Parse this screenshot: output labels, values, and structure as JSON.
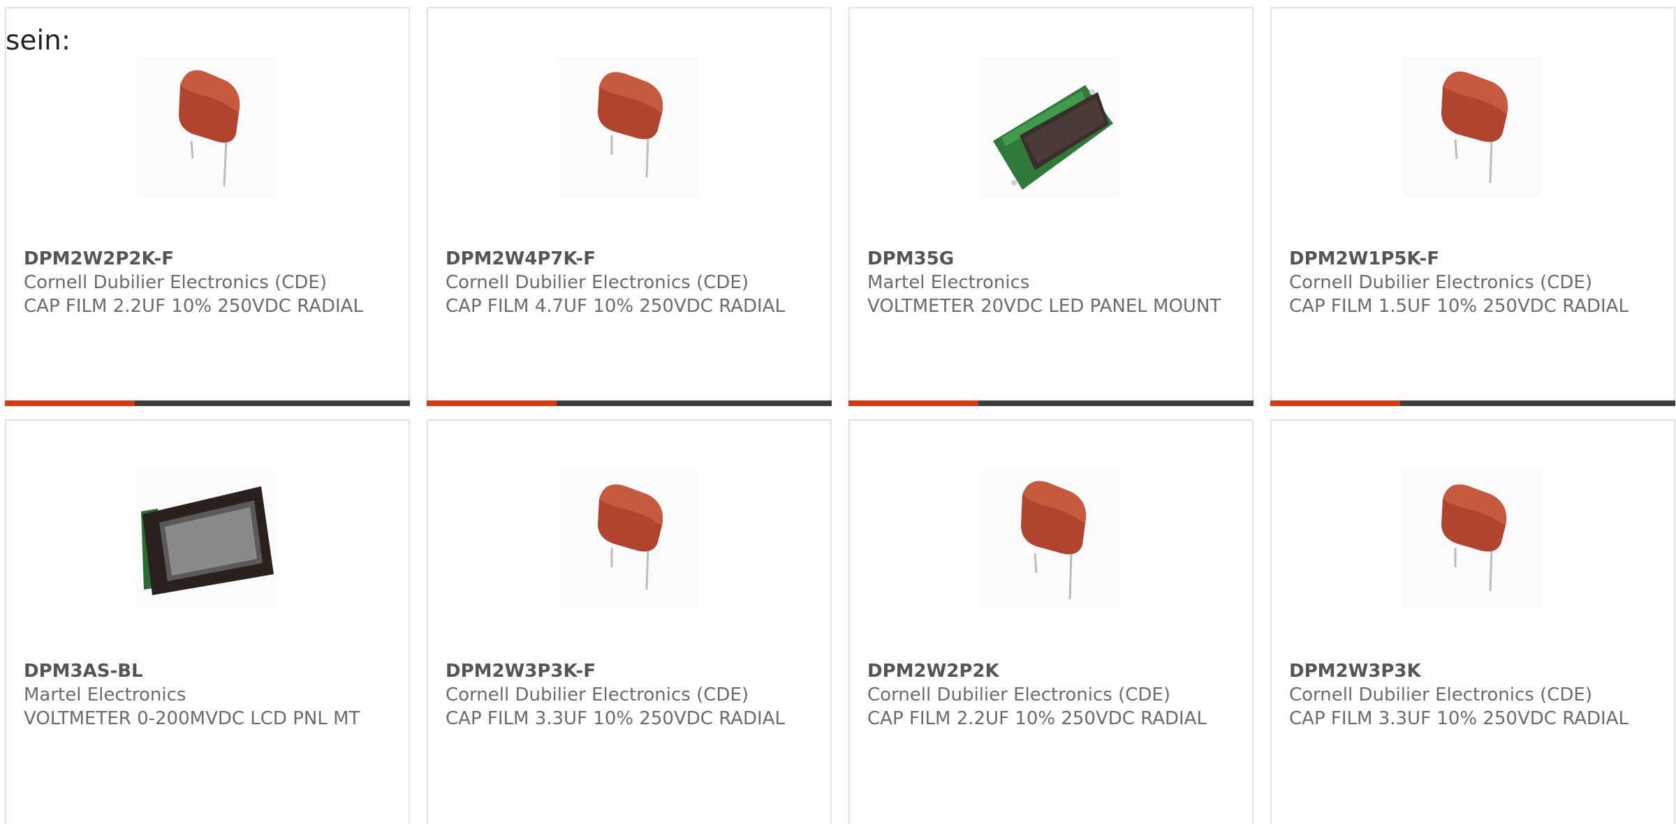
{
  "intro_text": "sein:",
  "colors": {
    "accent": "#d9370f",
    "bar": "#3d3d3d",
    "capacitor": "#b0442e"
  },
  "products": [
    {
      "part": "DPM2W2P2K-F",
      "manufacturer": "Cornell Dubilier Electronics (CDE)",
      "description": "CAP FILM 2.2UF 10% 250VDC RADIAL",
      "image": "film-capacitor-icon",
      "accent_progress": 0.32
    },
    {
      "part": "DPM2W4P7K-F",
      "manufacturer": "Cornell Dubilier Electronics (CDE)",
      "description": "CAP FILM 4.7UF 10% 250VDC RADIAL",
      "image": "film-capacitor-icon",
      "accent_progress": 0.32
    },
    {
      "part": "DPM35G",
      "manufacturer": "Martel Electronics",
      "description": "VOLTMETER 20VDC LED PANEL MOUNT",
      "image": "led-voltmeter-icon",
      "accent_progress": 0.32
    },
    {
      "part": "DPM2W1P5K-F",
      "manufacturer": "Cornell Dubilier Electronics (CDE)",
      "description": "CAP FILM 1.5UF 10% 250VDC RADIAL",
      "image": "film-capacitor-icon",
      "accent_progress": 0.32
    },
    {
      "part": "DPM3AS-BL",
      "manufacturer": "Martel Electronics",
      "description": "VOLTMETER 0-200MVDC LCD PNL MT",
      "image": "lcd-panel-meter-icon"
    },
    {
      "part": "DPM2W3P3K-F",
      "manufacturer": "Cornell Dubilier Electronics (CDE)",
      "description": "CAP FILM 3.3UF 10% 250VDC RADIAL",
      "image": "film-capacitor-icon"
    },
    {
      "part": "DPM2W2P2K",
      "manufacturer": "Cornell Dubilier Electronics (CDE)",
      "description": "CAP FILM 2.2UF 10% 250VDC RADIAL",
      "image": "film-capacitor-icon"
    },
    {
      "part": "DPM2W3P3K",
      "manufacturer": "Cornell Dubilier Electronics (CDE)",
      "description": "CAP FILM 3.3UF 10% 250VDC RADIAL",
      "image": "film-capacitor-icon"
    }
  ]
}
